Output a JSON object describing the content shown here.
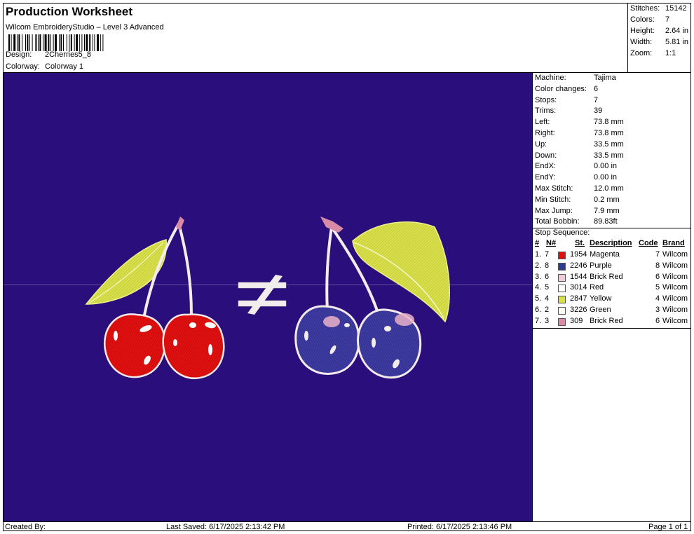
{
  "header": {
    "title": "Production Worksheet",
    "software": "Wilcom EmbroideryStudio – Level 3 Advanced",
    "design_label": "Design:",
    "design_value": "2Cherries5_8",
    "colorway_label": "Colorway:",
    "colorway_value": "Colorway 1"
  },
  "stats": {
    "stitches_label": "Stitches:",
    "stitches_value": "15142",
    "colors_label": "Colors:",
    "colors_value": "7",
    "height_label": "Height:",
    "height_value": "2.64 in",
    "width_label": "Width:",
    "width_value": "5.81 in",
    "zoom_label": "Zoom:",
    "zoom_value": "1:1"
  },
  "machine": [
    {
      "label": "Machine:",
      "value": "Tajima"
    },
    {
      "label": "Color changes:",
      "value": "6"
    },
    {
      "label": "Stops:",
      "value": "7"
    },
    {
      "label": "Trims:",
      "value": "39"
    },
    {
      "label": "Left:",
      "value": "73.8 mm"
    },
    {
      "label": "Right:",
      "value": "73.8 mm"
    },
    {
      "label": "Up:",
      "value": "33.5 mm"
    },
    {
      "label": "Down:",
      "value": "33.5 mm"
    },
    {
      "label": "EndX:",
      "value": "0.00 in"
    },
    {
      "label": "EndY:",
      "value": "0.00 in"
    },
    {
      "label": "Max Stitch:",
      "value": "12.0 mm"
    },
    {
      "label": "Min Stitch:",
      "value": "0.2 mm"
    },
    {
      "label": "Max Jump:",
      "value": "7.9 mm"
    },
    {
      "label": "Total Bobbin:",
      "value": "89.83ft"
    }
  ],
  "stop_sequence": {
    "title": "Stop Sequence:",
    "headers": {
      "num": "#",
      "n": "N#",
      "st": "St.",
      "description": "Description",
      "code": "Code",
      "brand": "Brand"
    },
    "rows": [
      {
        "num": "1.",
        "n": "7",
        "st": "1954",
        "description": "Magenta",
        "code": "7",
        "brand": "Wilcom",
        "color": "#e01010"
      },
      {
        "num": "2.",
        "n": "8",
        "st": "2246",
        "description": "Purple",
        "code": "8",
        "brand": "Wilcom",
        "color": "#2f3b8c"
      },
      {
        "num": "3.",
        "n": "6",
        "st": "1544",
        "description": "Brick Red",
        "code": "6",
        "brand": "Wilcom",
        "color": "#f4c8dc"
      },
      {
        "num": "4.",
        "n": "5",
        "st": "3014",
        "description": "Red",
        "code": "5",
        "brand": "Wilcom",
        "color": "#ffffff"
      },
      {
        "num": "5.",
        "n": "4",
        "st": "2847",
        "description": "Yellow",
        "code": "4",
        "brand": "Wilcom",
        "color": "#d8df4a"
      },
      {
        "num": "6.",
        "n": "2",
        "st": "3226",
        "description": "Green",
        "code": "3",
        "brand": "Wilcom",
        "color": "#fdfdf0"
      },
      {
        "num": "7.",
        "n": "3",
        "st": "309",
        "description": "Brick Red",
        "code": "6",
        "brand": "Wilcom",
        "color": "#d88aa6"
      }
    ]
  },
  "footer": {
    "created_by": "Created By:",
    "last_saved": "Last Saved: 6/17/2025 2:13:42 PM",
    "printed": "Printed: 6/17/2025 2:13:46 PM",
    "page": "Page 1 of 1"
  },
  "colors": {
    "canvas_bg": "#2a0f7c",
    "cherry_red": "#e01010",
    "cherry_blue": "#3d3aa0",
    "leaf": "#d8df4a",
    "stem": "#f0e8e8",
    "stem_tip": "#d88aa6"
  }
}
